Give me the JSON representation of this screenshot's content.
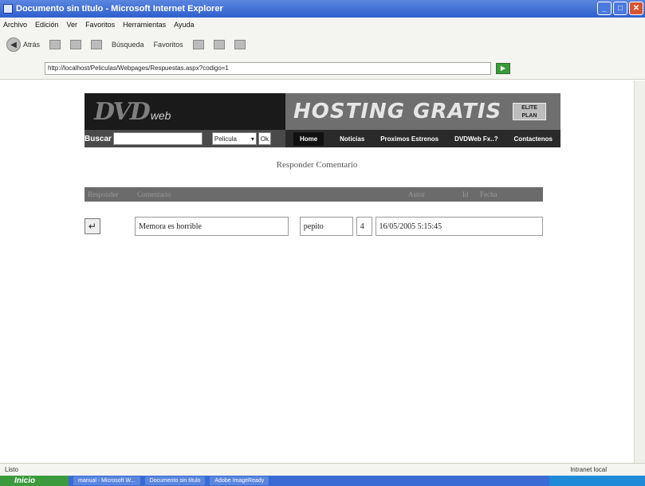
{
  "window": {
    "title": "Documento sin título - Microsoft Internet Explorer"
  },
  "menubar": [
    "Archivo",
    "Edición",
    "Ver",
    "Favoritos",
    "Herramientas",
    "Ayuda"
  ],
  "toolbar": {
    "back": "Atrás",
    "search": "Búsqueda",
    "favorites": "Favoritos"
  },
  "address": {
    "url": "http://localhost/Peliculas/Webpages/Respuestas.aspx?codigo=1"
  },
  "site": {
    "logo_main": "DVD",
    "logo_sub": "web",
    "banner": "HOSTING GRATIS",
    "badge": "ELITE PLAN",
    "search_label": "Buscar",
    "search_value": "",
    "select_value": "Pelicula",
    "ok_label": "Ok",
    "nav": [
      "Home",
      "Noticias",
      "Proximos Estrenos",
      "DVDWeb Fx..?",
      "Contactenos"
    ]
  },
  "page": {
    "heading": "Responder Comentario",
    "columns": [
      "Responder",
      "Comentario",
      "Autor",
      "Id",
      "Fecha"
    ],
    "row": {
      "comentario": "Memora es horrible",
      "autor": "pepito",
      "id": "4",
      "fecha": "16/05/2005 5:15:45"
    }
  },
  "status": {
    "left": "Listo",
    "zone": "Intranet local"
  },
  "taskbar": {
    "start": "Inicio",
    "tasks": [
      "manual - Microsoft W...",
      "Documento sin título",
      "Adobe ImageReady"
    ]
  }
}
